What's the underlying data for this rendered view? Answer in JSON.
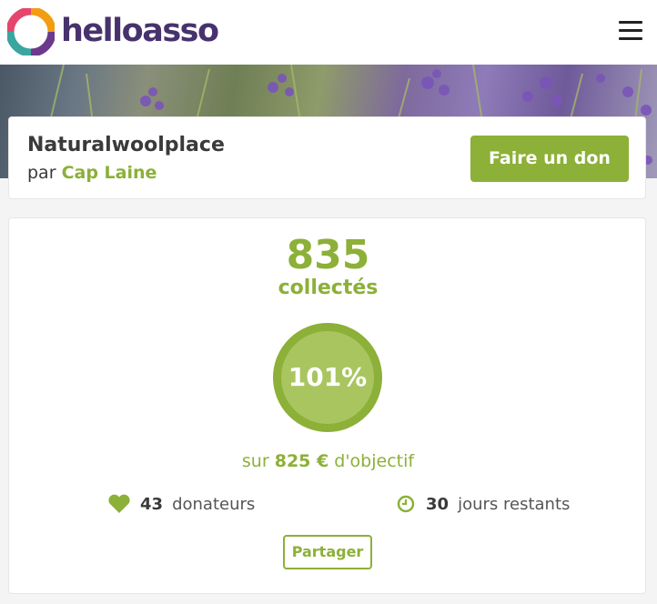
{
  "header": {
    "brand_name": "helloasso",
    "logo_icon": "helloasso-logo-icon",
    "menu_icon": "hamburger-menu-icon"
  },
  "campaign": {
    "title": "Naturalwoolplace",
    "by_prefix": "par",
    "organization": "Cap Laine",
    "donate_label": "Faire un don"
  },
  "stats": {
    "amount": "835",
    "collected_label": "collectés",
    "progress_percent": 101,
    "progress_label": "101%",
    "goal_prefix": "sur",
    "goal_amount": "825 €",
    "goal_suffix": "d'objectif",
    "donors_count": "43",
    "donors_label": "donateurs",
    "days_count": "30",
    "days_label": "jours restants",
    "share_label": "Partager"
  },
  "colors": {
    "accent": "#8cb038",
    "brand": "#47326e"
  }
}
